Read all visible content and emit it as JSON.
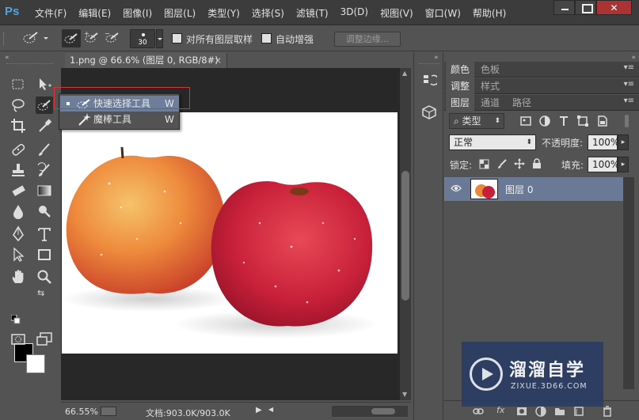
{
  "app": {
    "logo": "Ps",
    "menus": [
      "文件(F)",
      "编辑(E)",
      "图像(I)",
      "图层(L)",
      "类型(Y)",
      "选择(S)",
      "滤镜(T)",
      "3D(D)",
      "视图(V)",
      "窗口(W)",
      "帮助(H)"
    ],
    "close_glyph": "✕"
  },
  "options": {
    "brush_size": "30",
    "sample_all_layers_label": "对所有图层取样",
    "auto_enhance_label": "自动增强",
    "refine_edge_label": "调整边缘..."
  },
  "document": {
    "tab_title": "1.png @ 66.6% (图层 0, RGB/8#)",
    "tab_close": "×",
    "zoom": "66.55%",
    "doc_size": "文档:903.0K/903.0K"
  },
  "flyout": {
    "items": [
      {
        "label": "快速选择工具",
        "key": "W",
        "icon": "quick-selection-icon"
      },
      {
        "label": "魔棒工具",
        "key": "W",
        "icon": "magic-wand-icon"
      }
    ]
  },
  "panels": {
    "row1_tabs": [
      "颜色",
      "色板"
    ],
    "row2_tabs": [
      "调整",
      "样式"
    ],
    "row3_tabs": [
      "图层",
      "通道",
      "路径"
    ],
    "filter_kind": "类型",
    "blend_mode": "正常",
    "opacity_label": "不透明度:",
    "opacity_value": "100%",
    "lock_label": "锁定:",
    "fill_label": "填充:",
    "fill_value": "100%",
    "layer_name": "图层 0"
  },
  "watermark": {
    "title": "溜溜自学",
    "url": "ZIXUE.3D66.COM"
  },
  "colors": {
    "accent_selection": "#6e7e9a",
    "foreground": "#000000",
    "background": "#ffffff",
    "highlight_box": "#dd3333"
  }
}
